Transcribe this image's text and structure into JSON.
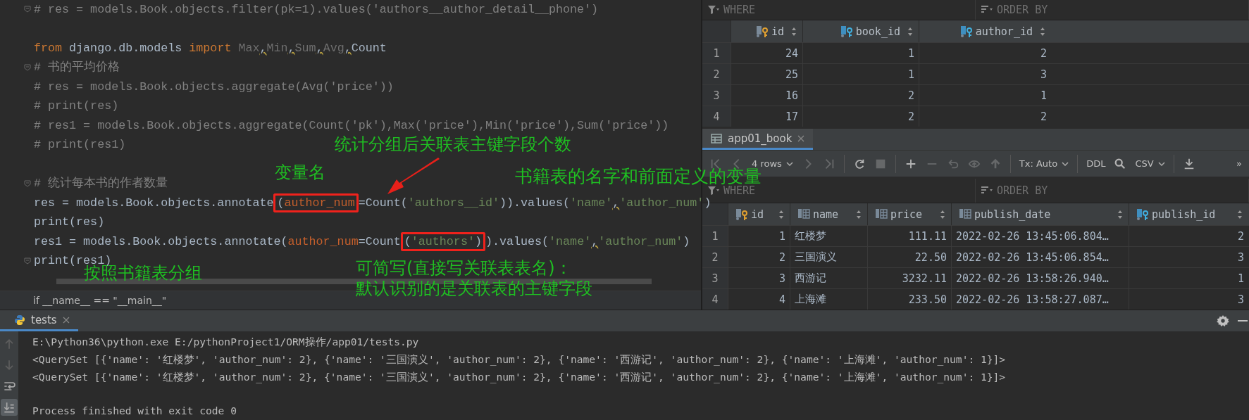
{
  "editor": {
    "lines": [
      {
        "kind": "code",
        "fold": true,
        "segments": [
          {
            "text": "# res = models.Book.objects.filter(pk=1).values('authors__author_detail__phone')",
            "kind": "comment"
          }
        ]
      },
      {
        "kind": "blank"
      },
      {
        "kind": "code",
        "fold": false,
        "segments": [
          {
            "text": "from ",
            "kind": "keyword"
          },
          {
            "text": "django.db.models ",
            "kind": "plain"
          },
          {
            "text": "import ",
            "kind": "keyword"
          },
          {
            "text": "Max",
            "kind": "faded"
          },
          {
            "text": ",",
            "kind": "warn"
          },
          {
            "text": "Min",
            "kind": "faded"
          },
          {
            "text": ",",
            "kind": "warn"
          },
          {
            "text": "Sum",
            "kind": "faded"
          },
          {
            "text": ",",
            "kind": "warn"
          },
          {
            "text": "Avg",
            "kind": "faded"
          },
          {
            "text": ",",
            "kind": "warn"
          },
          {
            "text": "Count",
            "kind": "plain"
          }
        ]
      },
      {
        "kind": "code",
        "fold": true,
        "segments": [
          {
            "text": "# 书的平均价格",
            "kind": "comment"
          }
        ]
      },
      {
        "kind": "code",
        "fold": false,
        "segments": [
          {
            "text": "# res = models.Book.objects.aggregate(Avg('price'))",
            "kind": "comment"
          }
        ]
      },
      {
        "kind": "code",
        "fold": false,
        "segments": [
          {
            "text": "# print(res)",
            "kind": "comment"
          }
        ]
      },
      {
        "kind": "code",
        "fold": false,
        "segments": [
          {
            "text": "# res1 = models.Book.objects.aggregate(Count('pk'),Max('price'),Min('price'),Sum('price'))",
            "kind": "comment"
          }
        ]
      },
      {
        "kind": "code",
        "fold": false,
        "segments": [
          {
            "text": "# print(res1)",
            "kind": "comment"
          }
        ]
      },
      {
        "kind": "blank"
      },
      {
        "kind": "code",
        "fold": true,
        "segments": [
          {
            "text": "# 统计每本书的作者数量",
            "kind": "comment"
          }
        ]
      },
      {
        "kind": "code",
        "fold": false,
        "segments": [
          {
            "text": "res = models.Book.objects.annotate",
            "kind": "plain"
          },
          {
            "text": "(",
            "kind": "plain",
            "boxed": true
          },
          {
            "text": "author_num",
            "kind": "param",
            "boxed": true
          },
          {
            "text": "=Count(",
            "kind": "plain"
          },
          {
            "text": "'authors__id'",
            "kind": "string"
          },
          {
            "text": ")).values(",
            "kind": "plain"
          },
          {
            "text": "'name'",
            "kind": "string"
          },
          {
            "text": ",",
            "kind": "warn"
          },
          {
            "text": "'author_num'",
            "kind": "string"
          },
          {
            "text": ")",
            "kind": "plain"
          }
        ]
      },
      {
        "kind": "code",
        "fold": false,
        "segments": [
          {
            "text": "print",
            "kind": "plain"
          },
          {
            "text": "(res)",
            "kind": "plain"
          }
        ]
      },
      {
        "kind": "code",
        "fold": false,
        "segments": [
          {
            "text": "res1 = models.Book.objects.annotate(",
            "kind": "plain"
          },
          {
            "text": "author_num",
            "kind": "param"
          },
          {
            "text": "=Count",
            "kind": "plain"
          },
          {
            "text": "(",
            "kind": "plain",
            "boxed": true
          },
          {
            "text": "'authors'",
            "kind": "string",
            "boxed": true
          },
          {
            "text": ")",
            "kind": "plain",
            "boxed": true
          },
          {
            "text": ").values(",
            "kind": "plain"
          },
          {
            "text": "'name'",
            "kind": "string"
          },
          {
            "text": ",",
            "kind": "warn"
          },
          {
            "text": "'author_num'",
            "kind": "string"
          },
          {
            "text": ")",
            "kind": "plain"
          }
        ]
      },
      {
        "kind": "code",
        "fold": true,
        "segments": [
          {
            "text": "print",
            "kind": "plain"
          },
          {
            "text": "(res1)",
            "kind": "plain"
          }
        ]
      }
    ],
    "breadcrumb": "if __name__ == \"__main__\""
  },
  "annotations": [
    {
      "text": "统计分组后关联表主键字段个数",
      "kind": "count"
    },
    {
      "text": "变量名",
      "kind": "variable"
    },
    {
      "text": "书籍表的名字和前面定义的变量",
      "kind": "name"
    },
    {
      "text": "按照书籍表分组",
      "kind": "group"
    },
    {
      "text": "可简写(直接写关联表表名)：",
      "kind": "short1"
    },
    {
      "text": "默认识别的是关联表的主键字段",
      "kind": "short2"
    }
  ],
  "relation_table": {
    "filter": {
      "where": "WHERE",
      "order_by": "ORDER BY"
    },
    "columns": [
      {
        "name": "id",
        "kind": "primary"
      },
      {
        "name": "book_id",
        "kind": "foreign"
      },
      {
        "name": "author_id",
        "kind": "foreign"
      }
    ],
    "rows": [
      {
        "num": "1",
        "cells": [
          "24",
          "1",
          "2"
        ]
      },
      {
        "num": "2",
        "cells": [
          "25",
          "1",
          "3"
        ]
      },
      {
        "num": "3",
        "cells": [
          "16",
          "2",
          "1"
        ]
      },
      {
        "num": "4",
        "cells": [
          "17",
          "2",
          "2"
        ]
      }
    ]
  },
  "book_tab": {
    "title": "app01_book"
  },
  "toolbar": [
    {
      "kind": "first",
      "disabled": true,
      "sep": false
    },
    {
      "kind": "prev",
      "disabled": true,
      "sep": false
    },
    {
      "kind": "rows",
      "label": "4 rows",
      "disabled": false,
      "sep": false
    },
    {
      "kind": "next",
      "disabled": true,
      "sep": false
    },
    {
      "kind": "last",
      "disabled": true,
      "sep": false
    },
    {
      "kind": "refresh",
      "disabled": false,
      "sep": true
    },
    {
      "kind": "stop",
      "disabled": true,
      "sep": false
    },
    {
      "kind": "add",
      "disabled": false,
      "sep": true
    },
    {
      "kind": "remove",
      "disabled": true,
      "sep": false
    },
    {
      "kind": "revert",
      "disabled": true,
      "sep": false
    },
    {
      "kind": "view",
      "disabled": true,
      "sep": false
    },
    {
      "kind": "submit",
      "disabled": true,
      "sep": false
    },
    {
      "kind": "rows",
      "label": "Tx: Auto",
      "disabled": false,
      "sep": true
    },
    {
      "kind": "text",
      "label": "DDL",
      "disabled": false,
      "sep": true
    },
    {
      "kind": "search",
      "disabled": false,
      "sep": false
    },
    {
      "kind": "rows",
      "label": "CSV",
      "disabled": false,
      "sep": false
    },
    {
      "kind": "download",
      "disabled": false,
      "sep": true
    },
    {
      "kind": "more",
      "label": "»",
      "disabled": false,
      "sep": false
    }
  ],
  "book_table": {
    "filter": {
      "where": "WHERE",
      "order_by": "ORDER BY"
    },
    "columns": [
      {
        "name": "id",
        "kind": "primary"
      },
      {
        "name": "name",
        "kind": "plain"
      },
      {
        "name": "price",
        "kind": "plain"
      },
      {
        "name": "publish_date",
        "kind": "plain"
      },
      {
        "name": "publish_id",
        "kind": "foreign"
      }
    ],
    "rows": [
      {
        "num": "1",
        "cells": [
          "1",
          "红楼梦",
          "111.11",
          "2022-02-26 13:45:06.804…",
          "2"
        ]
      },
      {
        "num": "2",
        "cells": [
          "2",
          "三国演义",
          "22.50",
          "2022-02-26 13:45:06.854…",
          "3"
        ]
      },
      {
        "num": "3",
        "cells": [
          "3",
          "西游记",
          "3232.11",
          "2022-02-26 13:58:26.940…",
          "1"
        ]
      },
      {
        "num": "4",
        "cells": [
          "4",
          "上海滩",
          "233.50",
          "2022-02-26 13:58:27.087…",
          "3"
        ]
      }
    ]
  },
  "run_panel": {
    "tab": "tests",
    "side_tools": [
      {
        "kind": "up",
        "disabled": true,
        "selected": false
      },
      {
        "kind": "down",
        "disabled": true,
        "selected": false
      },
      {
        "kind": "wrap",
        "disabled": false,
        "selected": false
      },
      {
        "kind": "end",
        "disabled": false,
        "selected": true
      }
    ],
    "output": [
      "E:\\Python36\\python.exe E:/pythonProject1/ORM操作/app01/tests.py",
      "<QuerySet [{'name': '红楼梦', 'author_num': 2}, {'name': '三国演义', 'author_num': 2}, {'name': '西游记', 'author_num': 2}, {'name': '上海滩', 'author_num': 1}]>",
      "<QuerySet [{'name': '红楼梦', 'author_num': 2}, {'name': '三国演义', 'author_num': 2}, {'name': '西游记', 'author_num': 2}, {'name': '上海滩', 'author_num': 1}]>"
    ],
    "exit_message": "Process finished with exit code 0"
  }
}
